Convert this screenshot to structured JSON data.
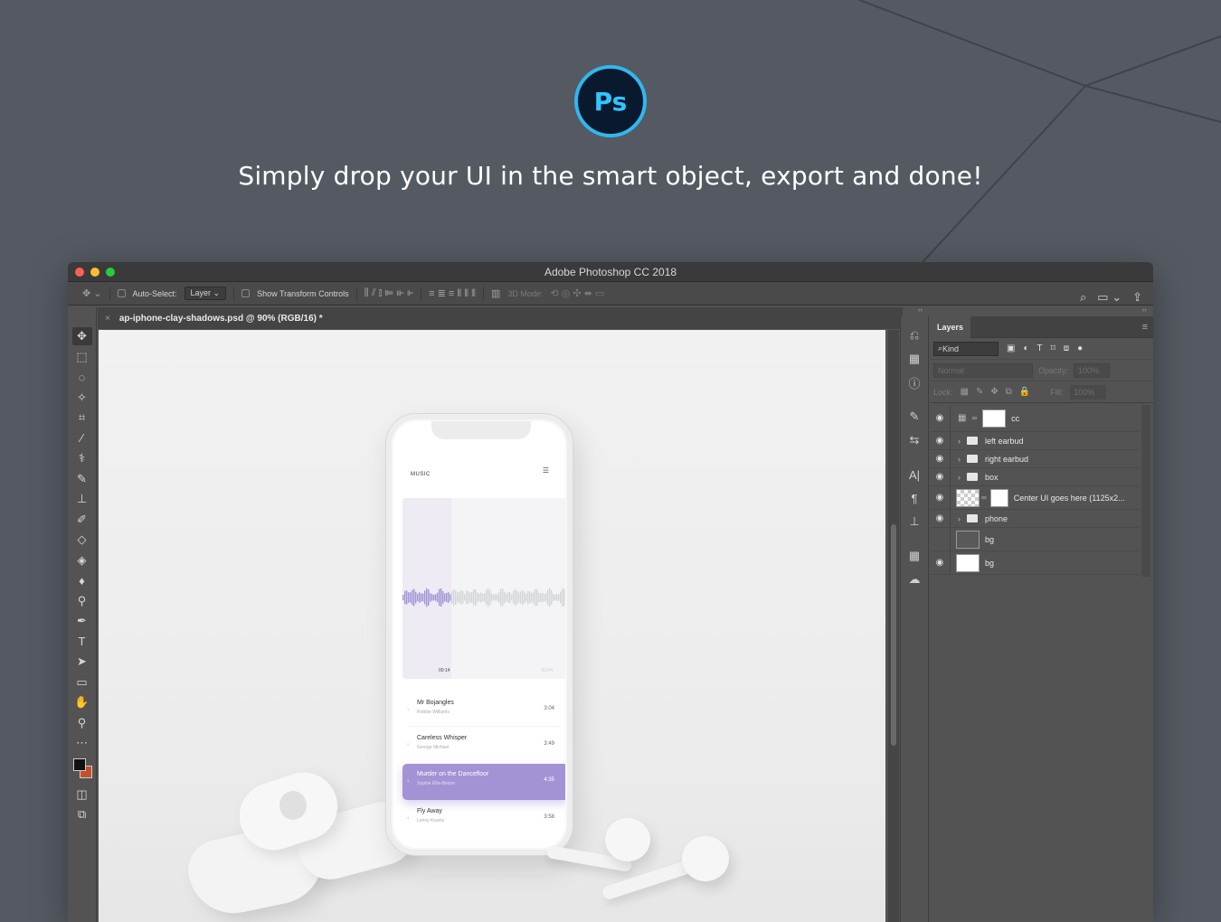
{
  "hero": {
    "logo_text": "Ps",
    "headline": "Simply drop your UI in the smart object, export and done!"
  },
  "window": {
    "title": "Adobe Photoshop CC 2018"
  },
  "options_bar": {
    "auto_select_label": "Auto-Select:",
    "auto_select_value": "Layer",
    "transform_label": "Show Transform Controls",
    "mode_3d_label": "3D Mode:"
  },
  "document": {
    "tab_title": "ap-iphone-clay-shadows.psd @ 90% (RGB/16) *"
  },
  "phone_ui": {
    "header": "MUSIC",
    "elapsed": "00:14",
    "remaining": "03:04",
    "tracks": [
      {
        "num": "1",
        "name": "Mr Bojangles",
        "artist": "Robbie Williams",
        "duration": "3:04"
      },
      {
        "num": "2",
        "name": "Careless Whisper",
        "artist": "George Michael",
        "duration": "3:49"
      },
      {
        "num": "3",
        "name": "Murder on the Dancefloor",
        "artist": "Sophie Ellis-Bextor",
        "duration": "4:35"
      },
      {
        "num": "4",
        "name": "Fly Away",
        "artist": "Lenny Kravitz",
        "duration": "3:58"
      }
    ]
  },
  "layers_panel": {
    "tab_label": "Layers",
    "filter_kind": "Kind",
    "blend_mode": "Normal",
    "opacity_label": "Opacity:",
    "opacity_value": "100%",
    "lock_label": "Lock:",
    "fill_label": "Fill:",
    "fill_value": "100%",
    "layers": [
      {
        "name": "cc",
        "type": "adjustment",
        "visible": true
      },
      {
        "name": "left earbud",
        "type": "group",
        "visible": true
      },
      {
        "name": "right earbud",
        "type": "group",
        "visible": true
      },
      {
        "name": "box",
        "type": "group",
        "visible": true
      },
      {
        "name": "Center UI goes here (1125x2...",
        "type": "smart-object",
        "visible": true
      },
      {
        "name": "phone",
        "type": "group",
        "visible": true
      },
      {
        "name": "bg",
        "type": "fill",
        "visible": false
      },
      {
        "name": "bg",
        "type": "fill",
        "visible": true
      }
    ]
  },
  "colors": {
    "page_bg": "#555a62",
    "ps_blue": "#31c5ff",
    "active_track": "#a393d4",
    "foreground_swatch": "#111111",
    "background_swatch": "#c4512b"
  }
}
